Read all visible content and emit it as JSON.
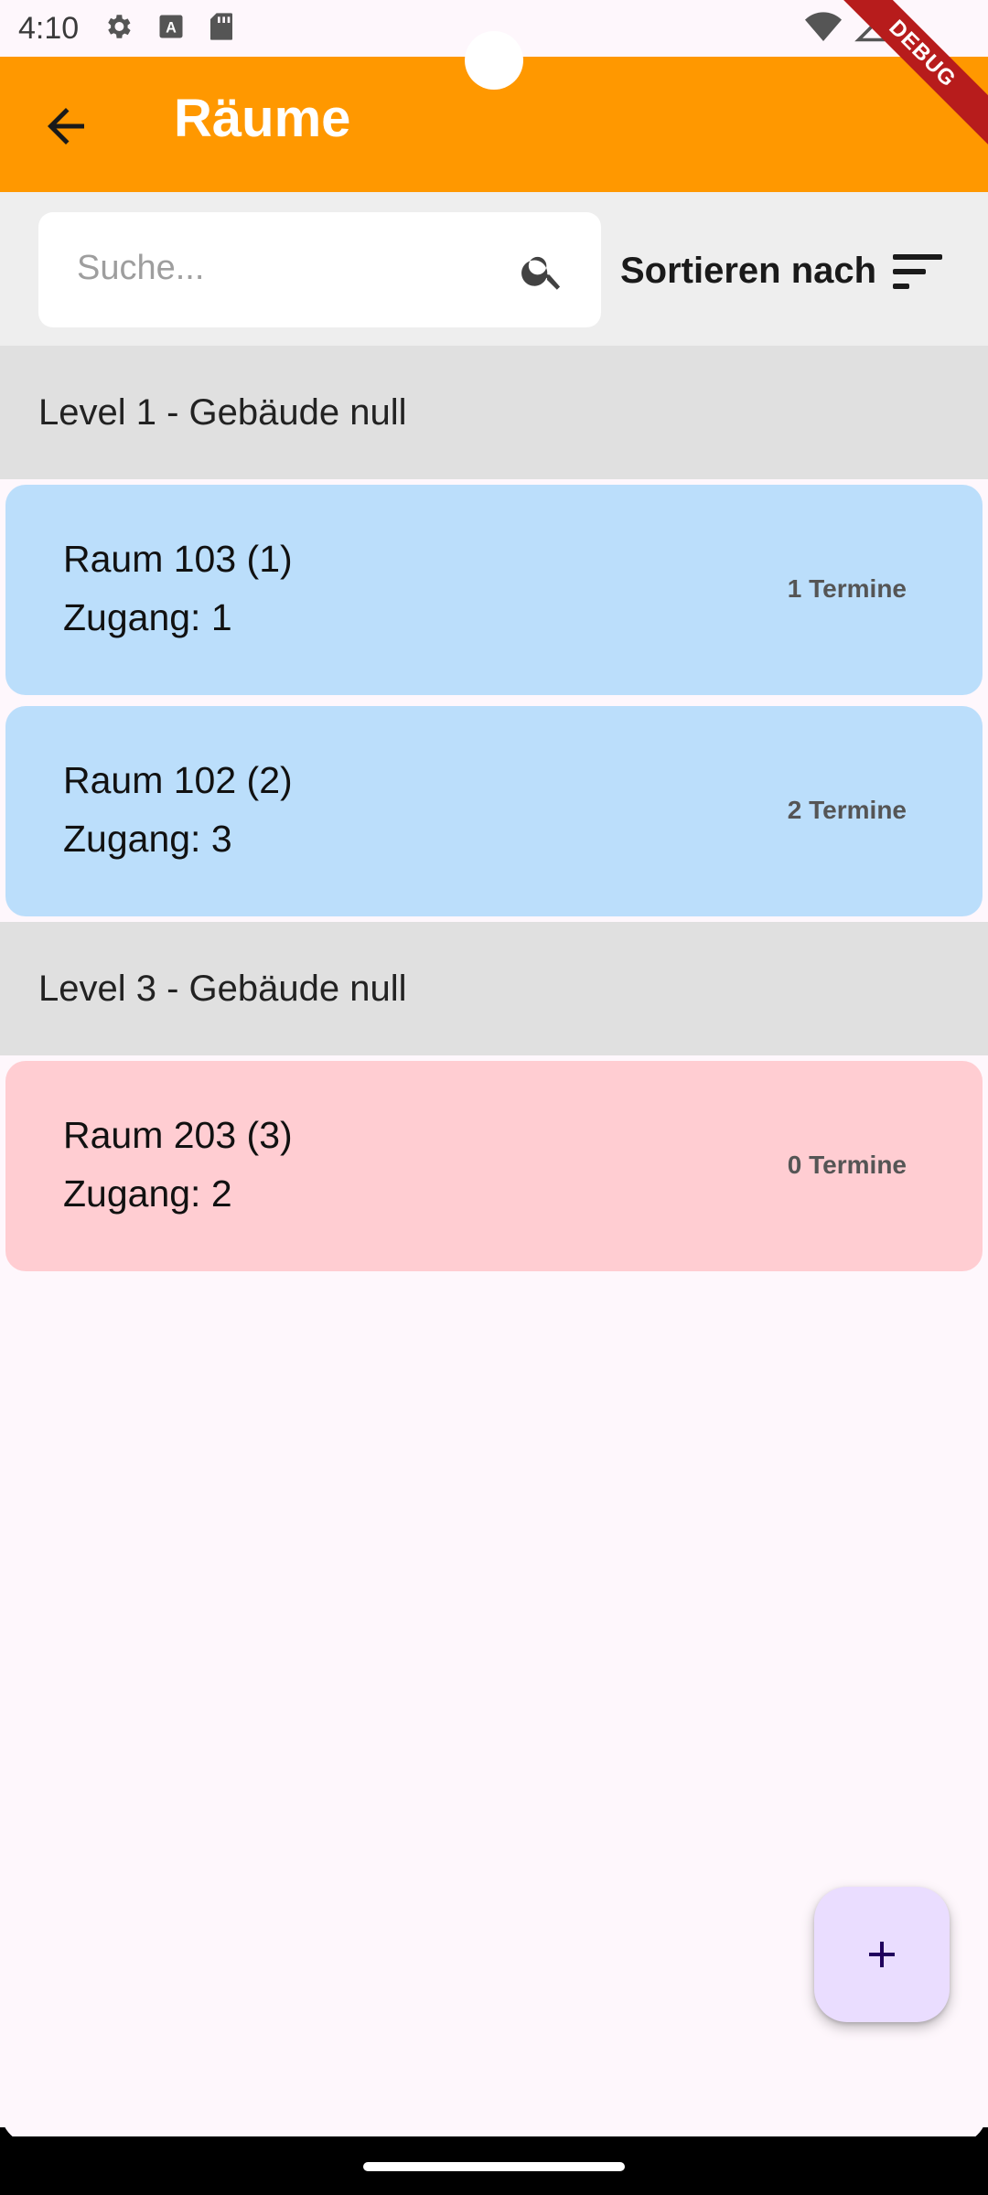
{
  "status_bar": {
    "time": "4:10"
  },
  "debug_banner": "DEBUG",
  "app_bar": {
    "title": "Räume"
  },
  "search": {
    "placeholder": "Suche..."
  },
  "sort": {
    "label": "Sortieren nach"
  },
  "sections": [
    {
      "header": "Level 1 - Gebäude null",
      "rooms": [
        {
          "name": "Raum 103 (1)",
          "access": "Zugang: 1",
          "count": "1 Termine",
          "color": "#bbdefb"
        },
        {
          "name": "Raum 102 (2)",
          "access": "Zugang: 3",
          "count": "2 Termine",
          "color": "#bbdefb"
        }
      ]
    },
    {
      "header": "Level 3 - Gebäude null",
      "rooms": [
        {
          "name": "Raum 203 (3)",
          "access": "Zugang: 2",
          "count": "0 Termine",
          "color": "#ffcdd2"
        }
      ]
    }
  ],
  "colors": {
    "app_bar": "#ff9800",
    "fab": "#eaddff",
    "debug": "#b71c1c"
  }
}
